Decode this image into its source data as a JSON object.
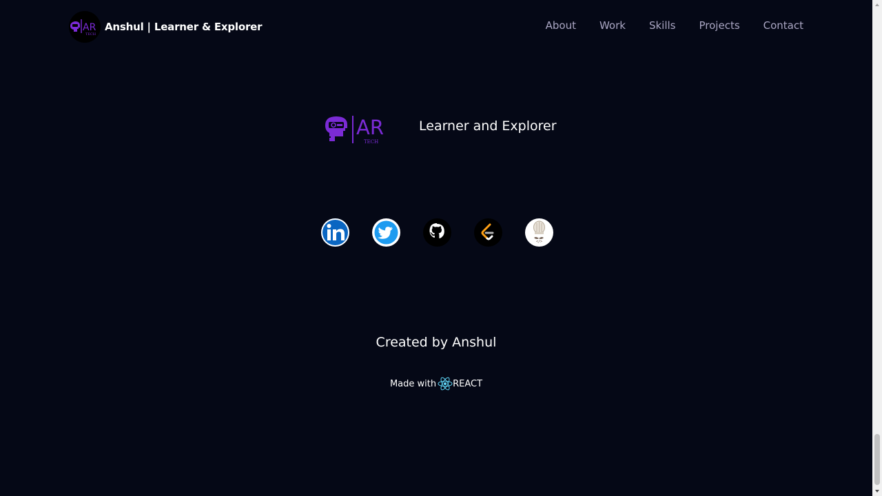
{
  "navbar": {
    "brand_logo_icon": "ar-tech-logo-icon",
    "brand_title": "Anshul | Learner & Explorer",
    "links": [
      {
        "label": "About"
      },
      {
        "label": "Work"
      },
      {
        "label": "Skills"
      },
      {
        "label": "Projects"
      },
      {
        "label": "Contact"
      }
    ]
  },
  "footer": {
    "logo": {
      "initials": "AR",
      "sub": "TECH"
    },
    "tagline": "Learner and Explorer",
    "socials": [
      {
        "name": "linkedin-icon",
        "color": "#0a66c2"
      },
      {
        "name": "twitter-icon",
        "color": "#1d9bf0"
      },
      {
        "name": "github-icon",
        "color": "#000000"
      },
      {
        "name": "leetcode-icon",
        "color": "#ffa116"
      },
      {
        "name": "codechef-icon",
        "color": "#5b4638"
      }
    ],
    "credit": "Created by Anshul",
    "made_with_prefix": "Made with",
    "made_with_suffix": "REACT"
  },
  "colors": {
    "background": "#050816",
    "nav_link": "#aaa6c3",
    "brand_purple": "#7b2bd6",
    "react_cyan": "#61dafb"
  }
}
